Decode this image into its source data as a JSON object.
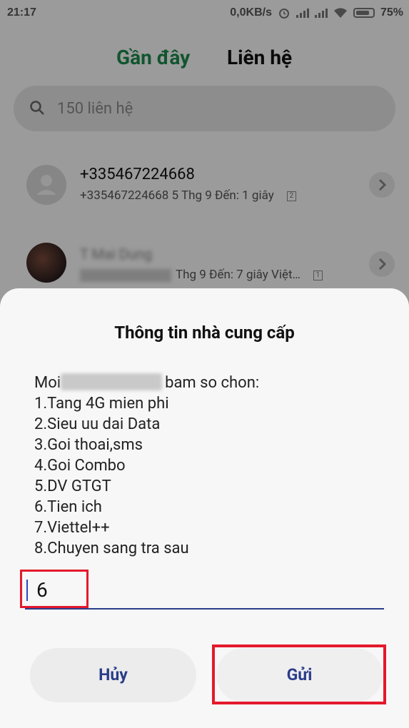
{
  "status_bar": {
    "time": "21:17",
    "network_speed": "0,0KB/s",
    "battery": "75%"
  },
  "tabs": {
    "recent": "Gần đây",
    "contacts": "Liên hệ"
  },
  "search": {
    "placeholder": "150 liên hệ"
  },
  "calls": [
    {
      "name": "+335467224668",
      "meta": "+335467224668  5 Thg 9 Đến: 1 giây",
      "sim": "2"
    },
    {
      "name": "T Mai Dung",
      "meta_hidden": "0123456789",
      "meta": "Thg 9 Đến: 7 giây  Việt…",
      "sim": "1"
    }
  ],
  "dialog": {
    "title": "Thông tin nhà cung cấp",
    "message_prefix": "Moi",
    "message_suffix": "bam so chon:",
    "options": [
      "1.Tang 4G mien phi",
      "2.Sieu uu dai Data",
      "3.Goi thoai,sms",
      "4.Goi Combo",
      "5.DV GTGT",
      "6.Tien ich",
      "7.Viettel++",
      "8.Chuyen sang tra sau"
    ],
    "input_value": "6",
    "cancel_label": "Hủy",
    "send_label": "Gửi"
  },
  "colors": {
    "accent_green": "#1c8a4d",
    "button_text": "#2a3c8a",
    "highlight_red": "#e4192c"
  }
}
